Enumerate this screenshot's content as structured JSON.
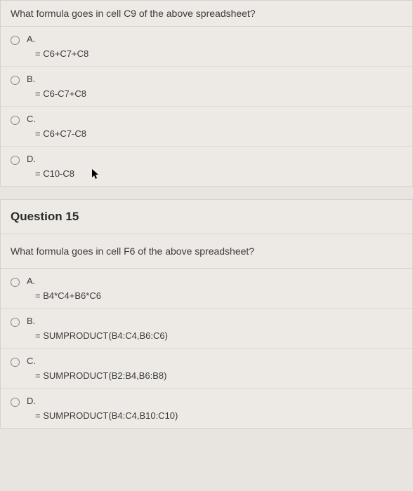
{
  "question1": {
    "prompt": "What formula goes in cell C9 of the above spreadsheet?",
    "options": [
      {
        "letter": "A.",
        "text": "= C6+C7+C8"
      },
      {
        "letter": "B.",
        "text": "= C6-C7+C8"
      },
      {
        "letter": "C.",
        "text": "= C6+C7-C8"
      },
      {
        "letter": "D.",
        "text": "= C10-C8"
      }
    ]
  },
  "question2": {
    "header": "Question 15",
    "prompt": "What formula goes in cell F6 of the above spreadsheet?",
    "options": [
      {
        "letter": "A.",
        "text": "= B4*C4+B6*C6"
      },
      {
        "letter": "B.",
        "text": "= SUMPRODUCT(B4:C4,B6:C6)"
      },
      {
        "letter": "C.",
        "text": "= SUMPRODUCT(B2:B4,B6:B8)"
      },
      {
        "letter": "D.",
        "text": "= SUMPRODUCT(B4:C4,B10:C10)"
      }
    ]
  }
}
